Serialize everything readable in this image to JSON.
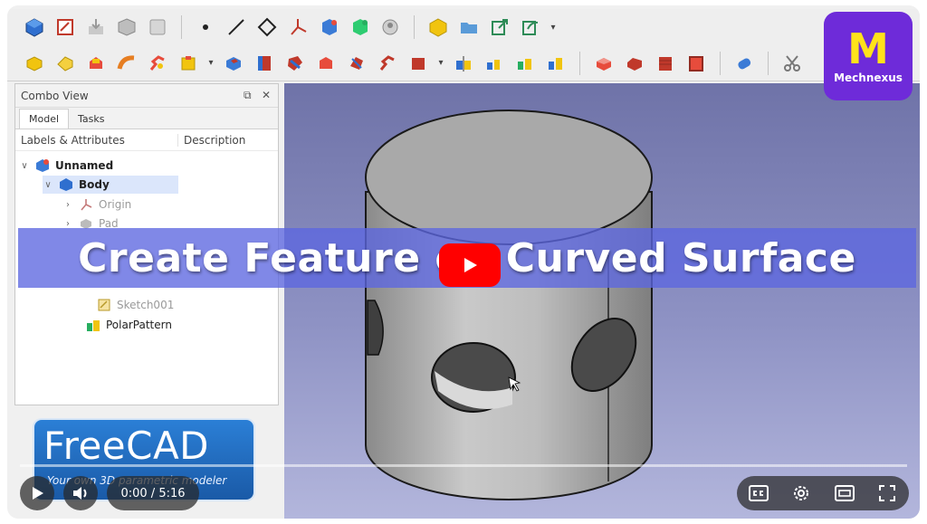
{
  "video": {
    "title_overlay": "Create Feature on Curved Surface",
    "current_time": "0:00",
    "duration": "5:16",
    "progress_fraction": 0.0,
    "accent_color": "#ff0000"
  },
  "channel_logo": {
    "letter": "M",
    "name": "Mechnexus"
  },
  "freecad_logo": {
    "title": "FreeCAD",
    "tagline": "Your own 3D parametric modeler"
  },
  "combo_view": {
    "title": "Combo View",
    "tabs": [
      {
        "label": "Model"
      },
      {
        "label": "Tasks"
      }
    ],
    "columns": {
      "labels": "Labels & Attributes",
      "description": "Description"
    },
    "tree": [
      {
        "label": "Unnamed",
        "level": 0
      },
      {
        "label": "Body",
        "level": 1
      },
      {
        "label": "Origin",
        "level": 2
      },
      {
        "label": "Pad",
        "level": 2
      },
      {
        "label": "Sketch001",
        "level": 3
      },
      {
        "label": "PolarPattern",
        "level": 2
      }
    ]
  },
  "toolbar_icons": {
    "row1": [
      "part-design-icon",
      "new-sketch-icon",
      "import-icon",
      "box-icon",
      "group-icon",
      "point-icon",
      "line-icon",
      "plane-icon",
      "axis-icon",
      "body-icon",
      "feature-icon",
      "clone-icon",
      "material-icon",
      "folder-icon",
      "export-icon",
      "send-icon"
    ],
    "row2": [
      "pad-icon",
      "revolve-icon",
      "loft-icon",
      "pipe-icon",
      "helix-icon",
      "additive-primitive-icon",
      "pocket-icon",
      "hole-icon",
      "groove-icon",
      "subtractive-loft-icon",
      "subtractive-pipe-icon",
      "subtractive-helix-icon",
      "subtractive-primitive-icon",
      "mirror-icon",
      "linear-pattern-icon",
      "polar-pattern-icon",
      "multitransform-icon",
      "fillet-icon",
      "chamfer-icon",
      "draft-icon",
      "thickness-icon",
      "boolean-icon",
      "cut-icon"
    ]
  },
  "player_controls": [
    "play-icon",
    "volume-icon",
    "captions-icon",
    "settings-icon",
    "miniplayer-icon",
    "fullscreen-icon"
  ]
}
